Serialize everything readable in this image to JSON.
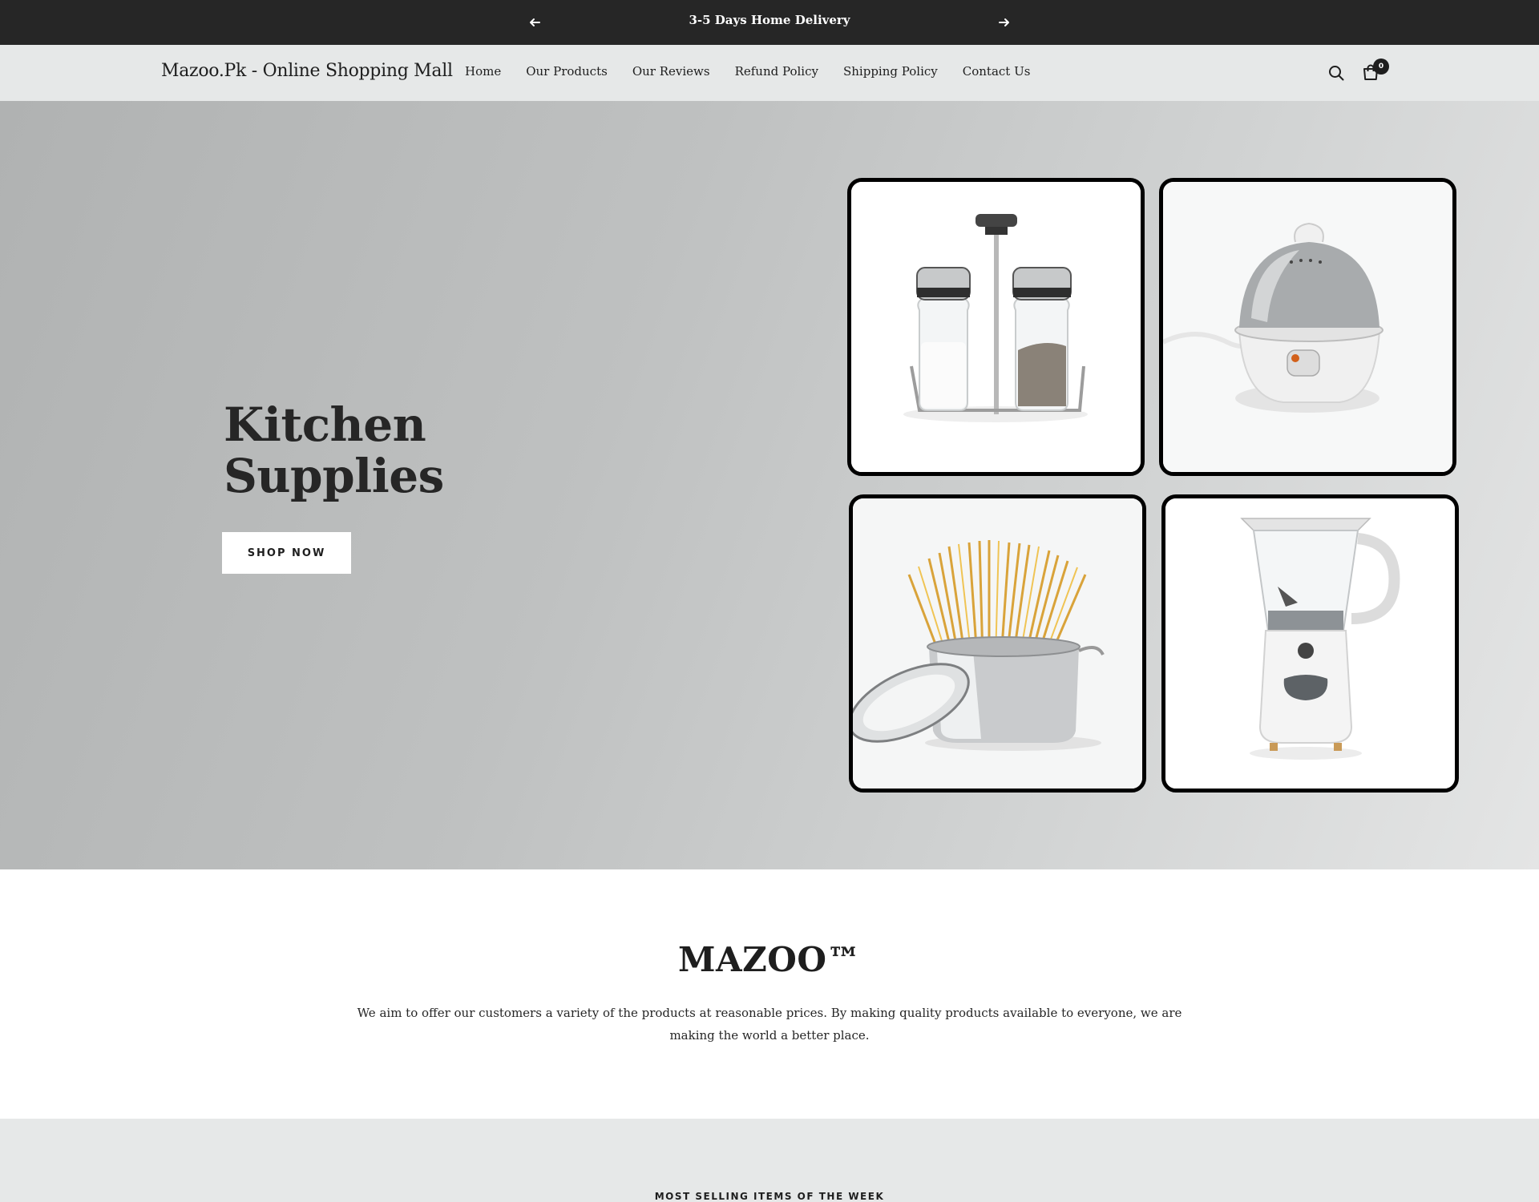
{
  "announcement": {
    "message": "3-5 Days Home Delivery",
    "prev_icon": "arrow-left-icon",
    "next_icon": "arrow-right-icon"
  },
  "header": {
    "logo": "Mazoo.Pk - Online Shopping Mall",
    "nav": [
      "Home",
      "Our Products",
      "Our Reviews",
      "Refund Policy",
      "Shipping Policy",
      "Contact Us"
    ],
    "cart_count": "0",
    "icons": [
      "search-icon",
      "cart-icon"
    ]
  },
  "hero": {
    "title_line1": "Kitchen",
    "title_line2": "Supplies",
    "button": "SHOP NOW",
    "images": [
      "salt-pepper-shakers",
      "egg-boiler",
      "spaghetti-pot",
      "blender"
    ]
  },
  "about": {
    "brand": "MAZOO™",
    "text": "We aim to offer our customers a variety of the products at reasonable prices. By making quality products available to everyone, we are making the world a better place."
  },
  "best_sellers": {
    "title": "MOST SELLING ITEMS OF THE WEEK"
  },
  "colors": {
    "announcement_bg": "#262626",
    "header_bg": "#e6e8e8",
    "text": "#1e1e1e"
  }
}
